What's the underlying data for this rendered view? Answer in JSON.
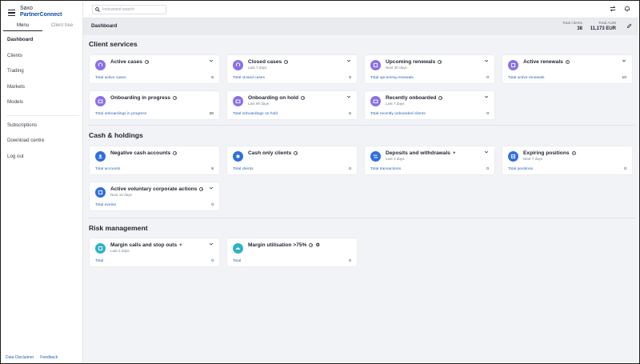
{
  "brand": {
    "line1": "Saxo",
    "line2": "PartnerConnect"
  },
  "sidebar": {
    "tabs": [
      {
        "label": "Menu",
        "active": true
      },
      {
        "label": "Client tree",
        "active": false
      }
    ],
    "items": [
      {
        "label": "Dashboard"
      },
      {
        "label": "Clients"
      },
      {
        "label": "Trading"
      },
      {
        "label": "Markets"
      },
      {
        "label": "Models"
      },
      {
        "label": "Subscriptions"
      },
      {
        "label": "Download centre"
      },
      {
        "label": "Log out"
      }
    ],
    "footer": {
      "disclaimer": "Data Disclaimer",
      "feedback": "Feedback"
    }
  },
  "topbar": {
    "search_placeholder": "Instrument search",
    "icons": [
      "transfer-icon",
      "bell-icon"
    ]
  },
  "header": {
    "title": "Dashboard",
    "total_clients_label": "Total clients",
    "total_clients_value": "38",
    "total_aum_label": "Total AUM",
    "total_aum_value": "11,173 EUR"
  },
  "sections": {
    "client_services": {
      "title": "Client services",
      "cards": [
        {
          "title": "Active cases",
          "sub": "",
          "link": "Total active cases",
          "count": "5",
          "icon": "cases-icon"
        },
        {
          "title": "Closed cases",
          "sub": "Last 7 days",
          "link": "Total closed cases",
          "count": "5",
          "icon": "cases-icon"
        },
        {
          "title": "Upcoming renewals",
          "sub": "Next 30 days",
          "link": "Total upcoming renewals",
          "count": "0",
          "icon": "renewal-icon"
        },
        {
          "title": "Active renewals",
          "sub": "",
          "link": "Total active renewals",
          "count": "10",
          "icon": "renewal-icon"
        },
        {
          "title": "Onboarding in progress",
          "sub": "",
          "link": "Total onboardings in progress",
          "count": "26",
          "icon": "onboarding-icon"
        },
        {
          "title": "Onboarding on hold",
          "sub": "Last 90 days",
          "link": "Total onboardings on hold",
          "count": "6",
          "icon": "onboarding-icon"
        },
        {
          "title": "Recently onboarded",
          "sub": "Last 7 days",
          "link": "Total recently onboarded clients",
          "count": "0",
          "icon": "onboarding-icon"
        }
      ]
    },
    "cash_holdings": {
      "title": "Cash & holdings",
      "cards": [
        {
          "title": "Negative cash accounts",
          "sub": "",
          "link": "Total accounts",
          "count": "8",
          "icon": "cash-icon"
        },
        {
          "title": "Cash only clients",
          "sub": "",
          "link": "Total clients",
          "count": "0",
          "icon": "cash-icon"
        },
        {
          "title": "Deposits and withdrawals",
          "sub": "Last 2 days",
          "link": "Total transactions",
          "count": "0",
          "icon": "transfer-icon"
        },
        {
          "title": "Expiring positions",
          "sub": "Next 7 days",
          "link": "Total positions",
          "count": "0",
          "icon": "positions-icon"
        },
        {
          "title": "Active voluntary corporate actions",
          "sub": "Next 10 days",
          "link": "Total events",
          "count": "0",
          "icon": "corporate-icon"
        }
      ]
    },
    "risk_management": {
      "title": "Risk management",
      "cards": [
        {
          "title": "Margin calls and stop outs",
          "sub": "Last 2 days",
          "link": "Total",
          "count": "0",
          "icon": "margin-icon"
        },
        {
          "title": "Margin utilisation >75%",
          "sub": "",
          "link": "Total",
          "count": "0",
          "icon": "gauge-icon"
        }
      ]
    }
  },
  "colors": {
    "purple": "#8a70e6",
    "blue": "#2f6fe0",
    "teal": "#2fb3c2",
    "link": "#2a62b8"
  }
}
